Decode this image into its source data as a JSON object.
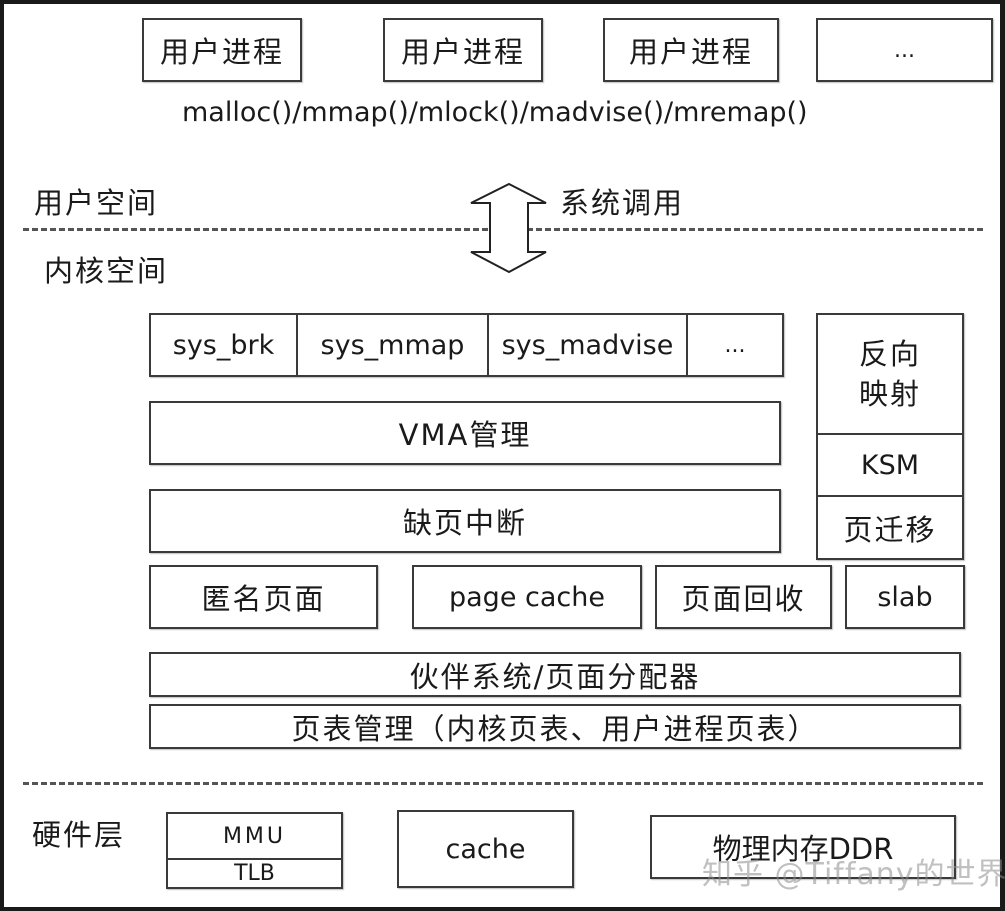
{
  "user_space": {
    "processes": [
      "用户进程",
      "用户进程",
      "用户进程",
      "..."
    ],
    "api_calls": "malloc()/mmap()/mlock()/madvise()/mremap()",
    "label": "用户空间"
  },
  "boundary": {
    "syscall_label": "系统调用",
    "arrow_icon": "double-arrow-vertical"
  },
  "kernel_space": {
    "label": "内核空间",
    "syscalls": [
      "sys_brk",
      "sys_mmap",
      "sys_madvise",
      "..."
    ],
    "vma": "VMA管理",
    "page_fault": "缺页中断",
    "anon_pages": "匿名页面",
    "page_cache": "page cache",
    "page_reclaim": "页面回收",
    "slab": "slab",
    "side_stack": {
      "reverse_mapping": [
        "反向",
        "映射"
      ],
      "ksm": "KSM",
      "page_migration": "页迁移"
    },
    "buddy_allocator": "伙伴系统/页面分配器",
    "page_table": "页表管理（内核页表、用户进程页表）"
  },
  "hardware": {
    "label": "硬件层",
    "mmu": "MMU",
    "tlb": "TLB",
    "cache": "cache",
    "ddr": "物理内存DDR"
  },
  "watermark": "知乎 @Tiffany的世界"
}
